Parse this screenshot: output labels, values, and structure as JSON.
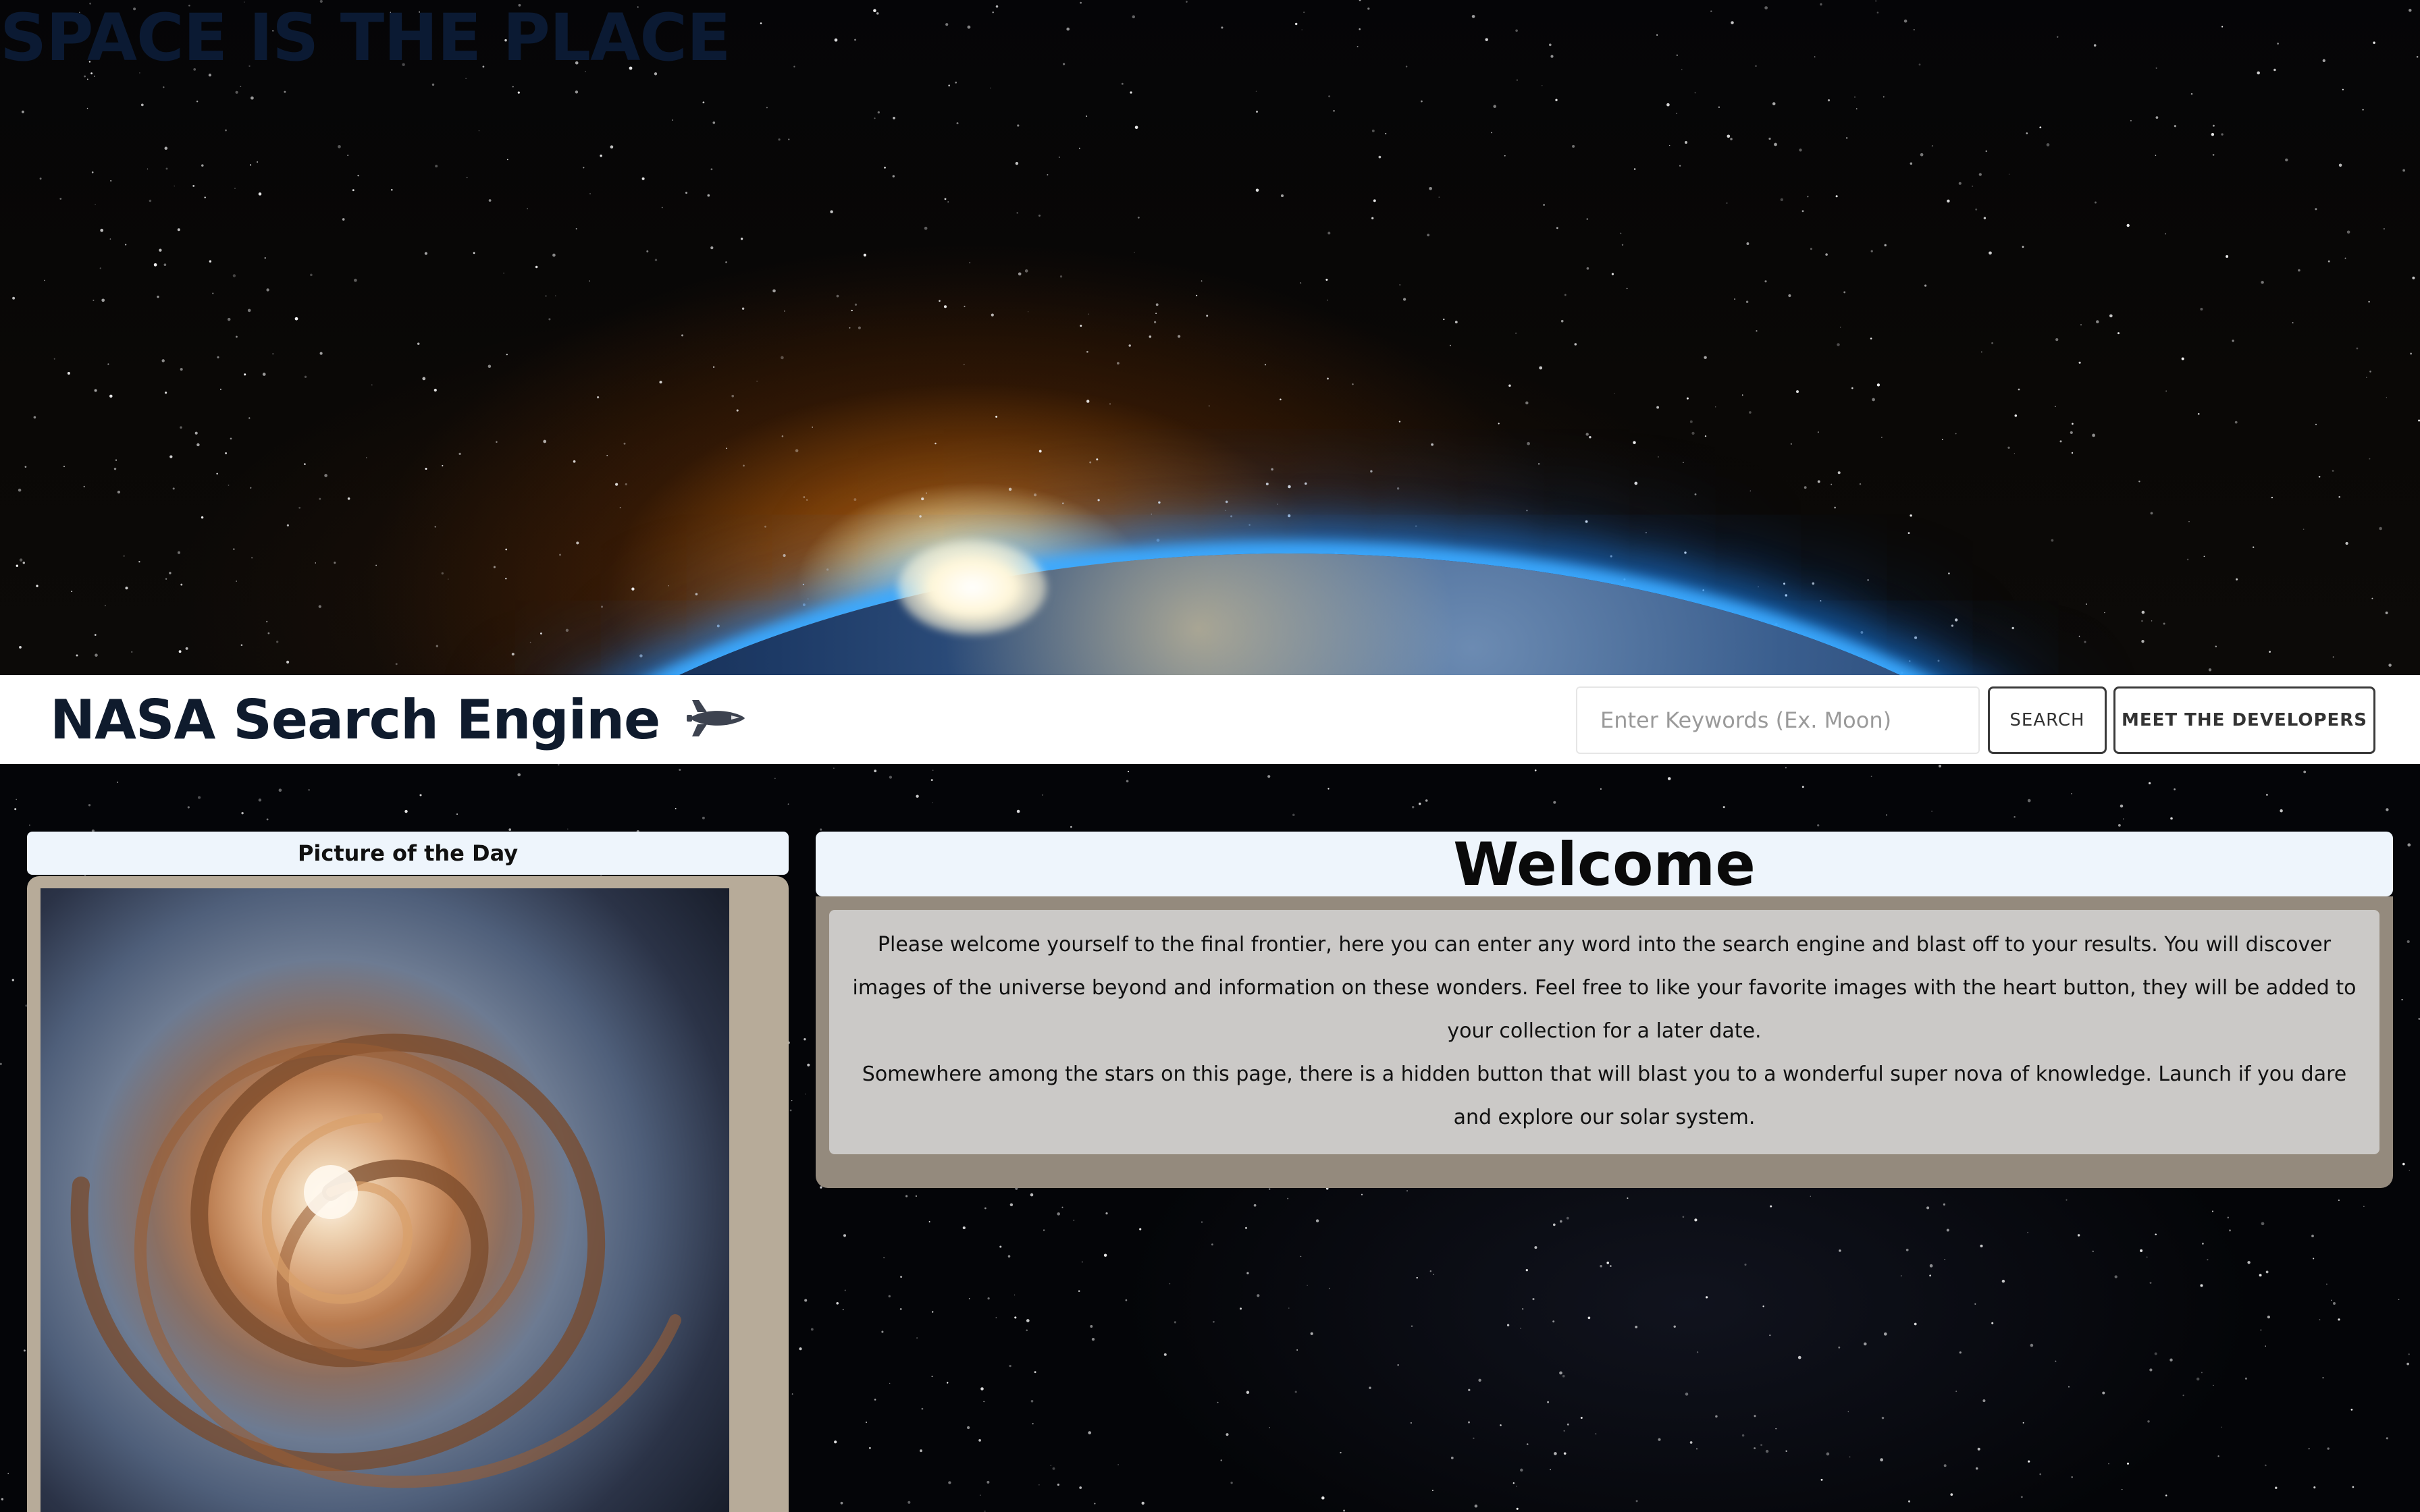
{
  "hero": {
    "title": "SPACE IS THE PLACE"
  },
  "navbar": {
    "brand": "NASA Search Engine",
    "brand_icon": "space-shuttle-icon",
    "search": {
      "placeholder": "Enter Keywords (Ex. Moon)",
      "value": ""
    },
    "search_button": "SEARCH",
    "developers_button": "MEET THE DEVELOPERS"
  },
  "potd": {
    "header": "Picture of the Day",
    "image_subject": "spiral galaxy"
  },
  "welcome": {
    "heading": "Welcome",
    "paragraph_1": "Please welcome yourself to the final frontier, here you can enter any word into the search engine and blast off to your results. You will discover images of the universe beyond and information on these wonders. Feel free to like your favorite images with the heart button, they will be added to your collection for a later date.",
    "paragraph_2": "Somewhere among the stars on this page, there is a hidden button that will blast you to a wonderful super nova of knowledge. Launch if you dare and explore our solar system."
  },
  "colors": {
    "brand_text": "#0f1b2d",
    "hero_title": "#0b1a33",
    "panel_header_bg": "#eef5fc",
    "potd_frame": "#b7ab99",
    "welcome_frame": "#948a7d",
    "welcome_body_bg": "#cbc9c7"
  }
}
